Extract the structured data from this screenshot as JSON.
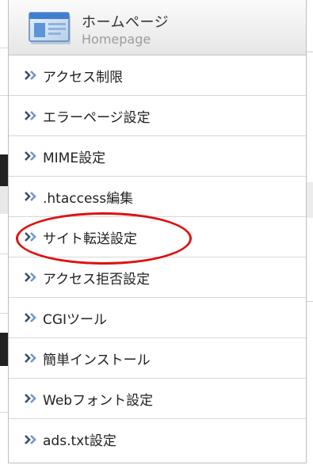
{
  "header": {
    "title": "ホームページ",
    "subtitle": "Homepage",
    "icon": "browser-window-icon"
  },
  "menu": {
    "items": [
      {
        "label": "アクセス制限"
      },
      {
        "label": "エラーページ設定"
      },
      {
        "label": "MIME設定"
      },
      {
        "label": ".htaccess編集"
      },
      {
        "label": "サイト転送設定"
      },
      {
        "label": "アクセス拒否設定"
      },
      {
        "label": "CGIツール"
      },
      {
        "label": "簡単インストール"
      },
      {
        "label": "Webフォント設定"
      },
      {
        "label": "ads.txt設定"
      }
    ],
    "bullet_icon": "double-chevron-right-icon"
  },
  "colors": {
    "arrow_dark": "#3c4f6b",
    "arrow_light": "#6f98c9",
    "highlight": "#dd1111",
    "icon_blue": "#3f7fcf"
  },
  "annotation": {
    "highlighted_item_index": 4
  }
}
